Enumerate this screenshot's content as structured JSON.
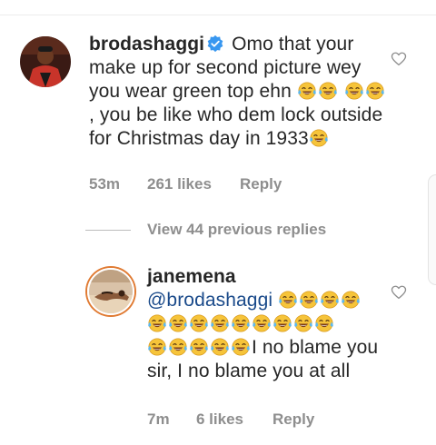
{
  "comment": {
    "username": "brodashaggi",
    "text_before_emoji": "Omo that your make up for second picture wey you wear green top  ehn ",
    "text_middle": ", you be like who dem lock outside for Christmas day in 1933",
    "time": "53m",
    "likes": "261 likes",
    "reply_label": "Reply",
    "verified": true
  },
  "view_replies_label": "View 44 previous replies",
  "reply": {
    "username": "janemena",
    "mention": "@brodashaggi",
    "text": "I no blame you sir, I no blame you at all",
    "time": "7m",
    "likes": "6 likes",
    "reply_label": "Reply"
  },
  "icons": {
    "verified": "verified-badge-icon",
    "emoji": "face-with-tears-of-joy-icon",
    "like": "heart-outline-icon"
  },
  "colors": {
    "text": "#262626",
    "meta": "#8e8e8e",
    "mention": "#1a4a8a",
    "verified": "#3897f0",
    "emoji": "#f6c43a",
    "tears": "#5bb8f0",
    "divider": "#bdbdbd"
  }
}
